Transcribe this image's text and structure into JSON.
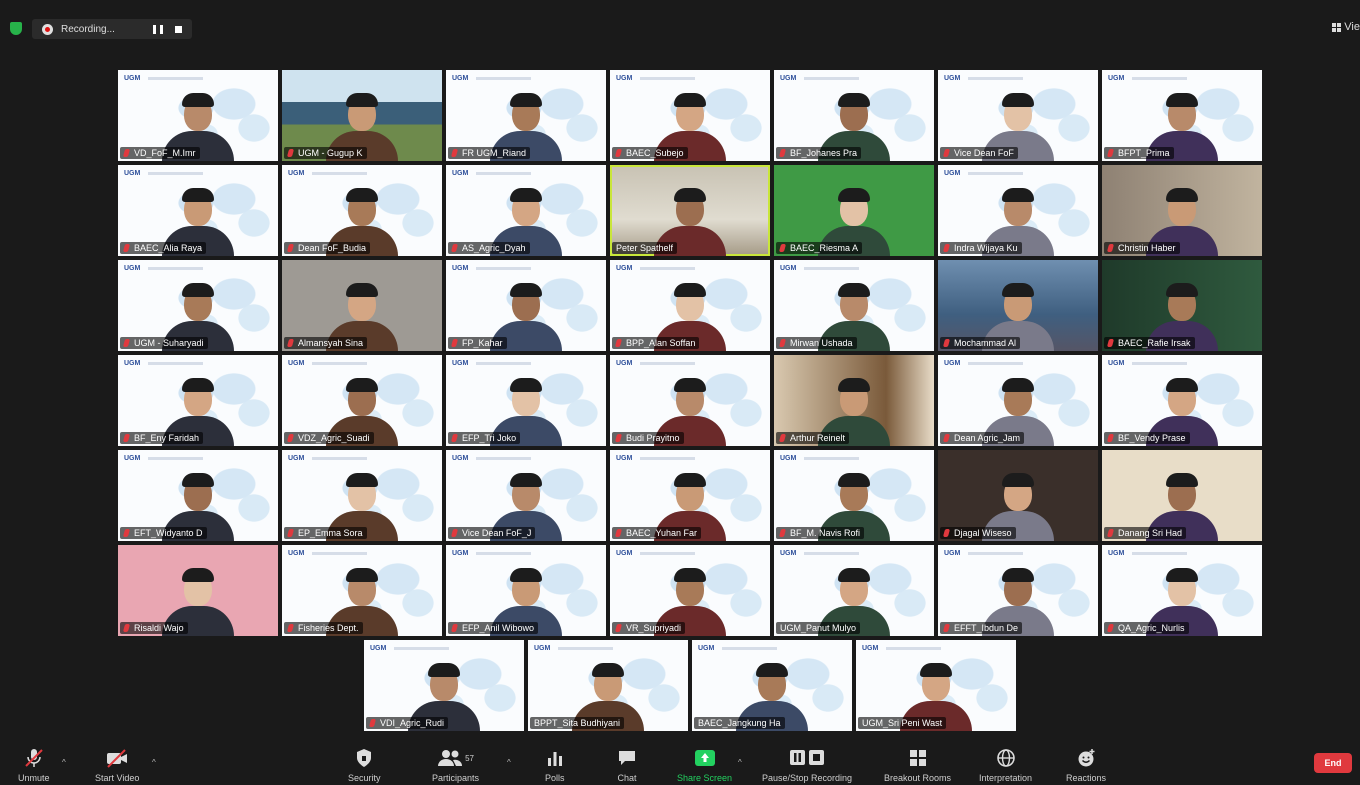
{
  "top": {
    "recording_label": "Recording...",
    "view_label": "Vie"
  },
  "tile_logo": "UGM",
  "rows": [
    [
      {
        "name": "VD_FoF_M.Imr",
        "bg": "slide",
        "mic": true
      },
      {
        "name": "UGM - Gugup K",
        "bg": "campus",
        "mic": true
      },
      {
        "name": "FR UGM_Riand",
        "bg": "slide",
        "mic": true
      },
      {
        "name": "BAEC_Subejo",
        "bg": "slide",
        "mic": true
      },
      {
        "name": "BF_Johanes Pra",
        "bg": "slide",
        "mic": true
      },
      {
        "name": "Vice Dean FoF",
        "bg": "slide",
        "mic": true
      },
      {
        "name": "BFPT_Prima",
        "bg": "slide",
        "mic": true
      }
    ],
    [
      {
        "name": "BAEC_Alia Raya",
        "bg": "slide",
        "mic": true
      },
      {
        "name": "Dean FoF_Budia",
        "bg": "slide",
        "mic": true
      },
      {
        "name": "AS_Agric_Dyah",
        "bg": "slide",
        "mic": true
      },
      {
        "name": "Peter Spathelf",
        "bg": "office",
        "mic": false,
        "active": true
      },
      {
        "name": "BAEC_Riesma A",
        "bg": "green",
        "mic": true
      },
      {
        "name": "Indra Wijaya Ku",
        "bg": "slide",
        "mic": true
      },
      {
        "name": "Christin Haber",
        "bg": "room",
        "mic": true
      }
    ],
    [
      {
        "name": "UGM - Suharyadi",
        "bg": "slide",
        "mic": true
      },
      {
        "name": "Almansyah Sina",
        "bg": "grey",
        "mic": true
      },
      {
        "name": "FP_Kahar",
        "bg": "slide",
        "mic": true
      },
      {
        "name": "BPP_Alan Soffan",
        "bg": "slide",
        "mic": true
      },
      {
        "name": "Mirwan Ushada",
        "bg": "slide",
        "mic": true
      },
      {
        "name": "Mochammad Al",
        "bg": "harbor",
        "mic": true
      },
      {
        "name": "BAEC_Rafie Irsak",
        "bg": "dark-green",
        "mic": true
      }
    ],
    [
      {
        "name": "BF_Eny Faridah",
        "bg": "slide",
        "mic": true
      },
      {
        "name": "VDZ_Agric_Suadi",
        "bg": "slide",
        "mic": true
      },
      {
        "name": "EFP_Tri Joko",
        "bg": "slide",
        "mic": true
      },
      {
        "name": "Budi Prayitno",
        "bg": "slide",
        "mic": true
      },
      {
        "name": "Arthur Reinelt",
        "bg": "wood",
        "mic": true
      },
      {
        "name": "Dean Agric_Jam",
        "bg": "slide",
        "mic": true
      },
      {
        "name": "BF_Vendy Prase",
        "bg": "slide",
        "mic": true
      }
    ],
    [
      {
        "name": "EFT_Widyanto D",
        "bg": "slide",
        "mic": true
      },
      {
        "name": "EP_Emma Sora",
        "bg": "slide",
        "mic": true
      },
      {
        "name": "Vice Dean FoF_J",
        "bg": "slide",
        "mic": true
      },
      {
        "name": "BAEC_Yuhan Far",
        "bg": "slide",
        "mic": true
      },
      {
        "name": "BF_M. Navis Rofi",
        "bg": "slide",
        "mic": true
      },
      {
        "name": "Djagal Wiseso",
        "bg": "dark",
        "mic": true
      },
      {
        "name": "Danang Sri Had",
        "bg": "cream",
        "mic": true
      }
    ],
    [
      {
        "name": "Risaldi Wajo",
        "bg": "pink",
        "mic": true
      },
      {
        "name": "Fisheries Dept.",
        "bg": "slide",
        "mic": true
      },
      {
        "name": "EFP_Anil Wibowo",
        "bg": "slide",
        "mic": true
      },
      {
        "name": "VR_Supriyadi",
        "bg": "slide",
        "mic": true
      },
      {
        "name": "UGM_Panut Mulyo",
        "bg": "slide",
        "mic": false
      },
      {
        "name": "EFFT_Ibdun De",
        "bg": "slide",
        "mic": true
      },
      {
        "name": "QA_Agric_Nurlis",
        "bg": "slide",
        "mic": true
      }
    ],
    [
      {
        "name": "VDI_Agric_Rudi",
        "bg": "slide",
        "mic": true
      },
      {
        "name": "BPPT_Sita Budhiyani",
        "bg": "slide",
        "mic": false
      },
      {
        "name": "BAEC_Jangkung Ha",
        "bg": "slide",
        "mic": false
      },
      {
        "name": "UGM_Sri Peni Wast",
        "bg": "slide",
        "mic": false
      }
    ]
  ],
  "toolbar": {
    "unmute": "Unmute",
    "start_video": "Start Video",
    "security": "Security",
    "participants": "Participants",
    "participants_count": "57",
    "polls": "Polls",
    "chat": "Chat",
    "share_screen": "Share Screen",
    "pause_stop_recording": "Pause/Stop Recording",
    "breakout_rooms": "Breakout Rooms",
    "interpretation": "Interpretation",
    "reactions": "Reactions",
    "end": "End"
  }
}
